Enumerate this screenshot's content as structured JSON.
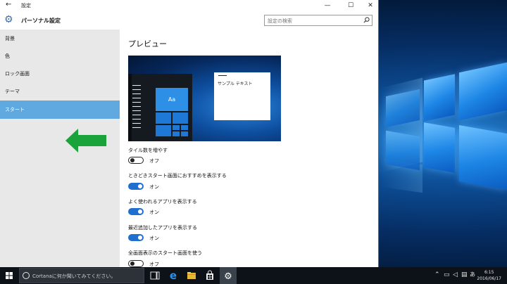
{
  "window": {
    "title": "設定",
    "back": "←",
    "minimize": "—",
    "maximize": "☐",
    "close": "✕"
  },
  "header": {
    "page_title": "パーソナル設定",
    "search_placeholder": "設定の検索"
  },
  "sidebar": {
    "items": [
      {
        "label": "背景"
      },
      {
        "label": "色"
      },
      {
        "label": "ロック画面"
      },
      {
        "label": "テーマ"
      },
      {
        "label": "スタート",
        "selected": true
      }
    ]
  },
  "main": {
    "preview_heading": "プレビュー",
    "preview": {
      "tile_label": "Aa",
      "sample_text": "サンプル テキスト"
    },
    "options": [
      {
        "label": "タイル数を増やす",
        "state": "オフ",
        "on": false
      },
      {
        "label": "ときどきスタート画面におすすめを表示する",
        "state": "オン",
        "on": true
      },
      {
        "label": "よく使われるアプリを表示する",
        "state": "オン",
        "on": true
      },
      {
        "label": "最近追加したアプリを表示する",
        "state": "オン",
        "on": true
      },
      {
        "label": "全画面表示のスタート画面を使う",
        "state": "オフ",
        "on": false
      }
    ]
  },
  "taskbar": {
    "cortana_placeholder": "Cortanaに何か聞いてみてください。",
    "time": "6:15",
    "date": "2016/06/17",
    "apps": [
      "task-view-icon",
      "edge-icon",
      "file-explorer-icon",
      "store-icon",
      "settings-icon"
    ]
  },
  "colors": {
    "accent": "#1f6fd0",
    "sidebar_selected": "#5fa8e0",
    "annotation_arrow": "#1aa33a"
  }
}
